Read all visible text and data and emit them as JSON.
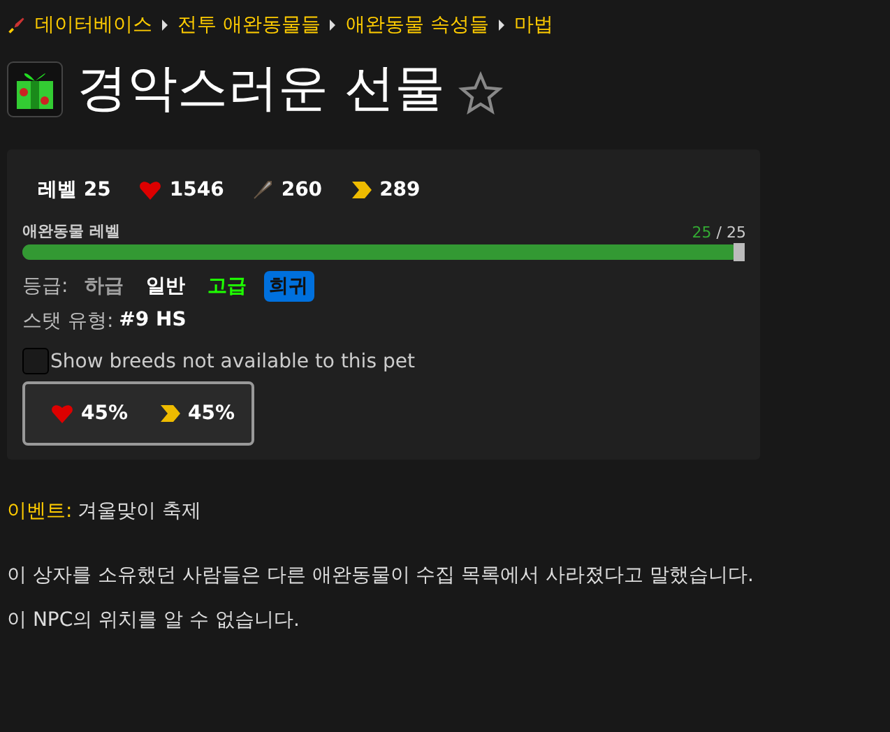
{
  "breadcrumb": [
    "데이터베이스",
    "전투 애완동물들",
    "애완동물 속성들",
    "마법"
  ],
  "title": "경악스러운 선물",
  "favorite": false,
  "stats": [
    {
      "kind": "level",
      "text": "레벨 25"
    },
    {
      "kind": "health",
      "text": "1546"
    },
    {
      "kind": "power",
      "text": "260"
    },
    {
      "kind": "speed",
      "text": "289"
    }
  ],
  "progress": {
    "label": "애완동물 레벨",
    "current": "25",
    "max": "/ 25",
    "level": 1
  },
  "quality": {
    "label": "등급:",
    "options": [
      {
        "label": "하급",
        "color": "#9d9d9d",
        "selected": false
      },
      {
        "label": "일반",
        "color": "#ffffff",
        "selected": false
      },
      {
        "label": "고급",
        "color": "#1eff00",
        "selected": false
      },
      {
        "label": "희귀",
        "color": "#0070dd",
        "selected": true
      }
    ]
  },
  "breed": {
    "label": "스탯 유형:",
    "value": "#9 HS"
  },
  "show_unavailable": {
    "label": "Show breeds not available to this pet",
    "checked": false
  },
  "breed_stats": [
    {
      "kind": "health",
      "text": "45%"
    },
    {
      "kind": "speed",
      "text": "45%"
    }
  ],
  "event": {
    "label": "이벤트:",
    "value": "겨울맞이 축제"
  },
  "paragraphs": [
    "이 상자를 소유했던 사람들은 다른 애완동물이 수집 목록에서 사라졌다고 말했습니다.",
    "이 NPC의 위치를 알 수 없습니다."
  ]
}
